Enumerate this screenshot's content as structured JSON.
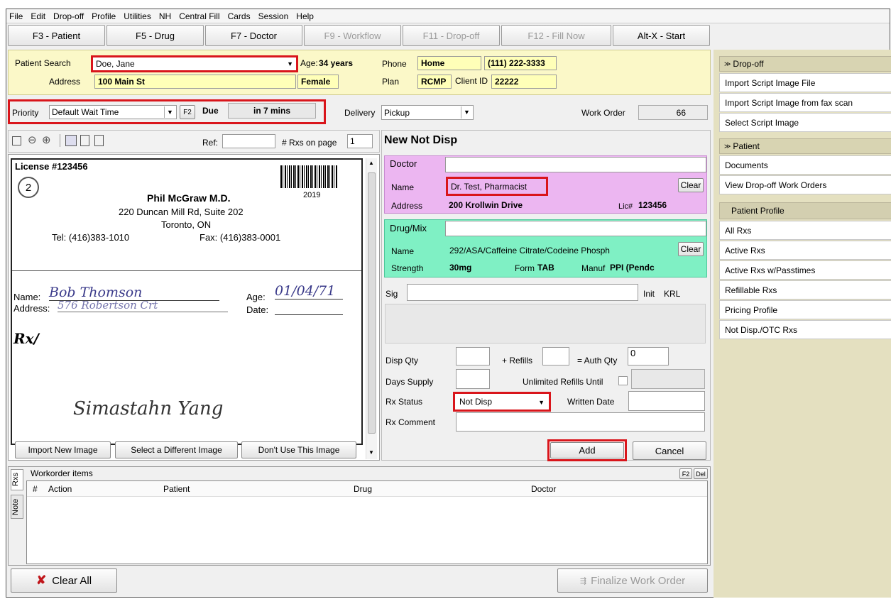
{
  "menu": [
    "File",
    "Edit",
    "Drop-off",
    "Profile",
    "Utilities",
    "NH",
    "Central Fill",
    "Cards",
    "Session",
    "Help"
  ],
  "fkeys": [
    {
      "label": "F3 - Patient",
      "enabled": true
    },
    {
      "label": "F5 - Drug",
      "enabled": true
    },
    {
      "label": "F7 - Doctor",
      "enabled": true
    },
    {
      "label": "F9 - Workflow",
      "enabled": false
    },
    {
      "label": "F11 - Drop-off",
      "enabled": false
    },
    {
      "label": "F12 - Fill Now",
      "enabled": false
    },
    {
      "label": "Alt-X - Start",
      "enabled": true
    }
  ],
  "patient": {
    "search_label": "Patient Search",
    "search_value": "Doe, Jane",
    "age_label": "Age:",
    "age_value": "34 years",
    "phone_label": "Phone",
    "phone_type": "Home",
    "phone_value": "(111) 222-3333",
    "address_label": "Address",
    "address_value": "100 Main St",
    "gender": "Female",
    "plan_label": "Plan",
    "plan_value": "RCMP",
    "client_id_label": "Client ID",
    "client_id_value": "22222"
  },
  "priority": {
    "label": "Priority",
    "value": "Default Wait Time",
    "f2": "F2",
    "due_label": "Due",
    "due_value": "in 7 mins"
  },
  "delivery": {
    "label": "Delivery",
    "value": "Pickup"
  },
  "work_order": {
    "label": "Work Order",
    "value": "66"
  },
  "image_toolbar": {
    "ref_label": "Ref:",
    "ref_value": "",
    "rxs_label": "# Rxs on page",
    "rxs_value": "1"
  },
  "script_image": {
    "license": "License #123456",
    "number": "2",
    "doctor": "Phil McGraw M.D.",
    "year": "2019",
    "address1": "220 Duncan Mill Rd, Suite 202",
    "address2": "Toronto, ON",
    "tel": "Tel: (416)383-1010",
    "fax": "Fax: (416)383-0001",
    "name_label": "Name:",
    "name_value": "Bob Thomson",
    "age_label": "Age:",
    "age_value": "01/04/71",
    "address_label": "Address:",
    "address_value": "576 Robertson Crt",
    "date_label": "Date:",
    "rx": "Rx/",
    "signature": "Simastahn Yang"
  },
  "image_buttons": [
    "Import New Image",
    "Select a Different Image",
    "Don't Use This Image"
  ],
  "form": {
    "title": "New Not Disp",
    "doctor_section": "Doctor",
    "doctor_name_label": "Name",
    "doctor_name": "Dr. Test, Pharmacist",
    "clear": "Clear",
    "doctor_address_label": "Address",
    "doctor_address": "200 Krollwin Drive",
    "lic_label": "Lic#",
    "lic_value": "123456",
    "drug_section": "Drug/Mix",
    "drug_name_label": "Name",
    "drug_name": "292/ASA/Caffeine Citrate/Codeine Phosph",
    "strength_label": "Strength",
    "strength_value": "30mg",
    "form_label": "Form",
    "form_value": "TAB",
    "manuf_label": "Manuf",
    "manuf_value": "PPI (Pendc",
    "sig_label": "Sig",
    "init_label": "Init",
    "init_value": "KRL",
    "disp_qty_label": "Disp Qty",
    "refills_label": "+ Refills",
    "auth_qty_label": "= Auth Qty",
    "auth_qty_value": "0",
    "days_supply_label": "Days Supply",
    "unlimited_label": "Unlimited Refills Until",
    "rx_status_label": "Rx Status",
    "rx_status_value": "Not Disp",
    "written_date_label": "Written Date",
    "rx_comment_label": "Rx Comment",
    "add": "Add",
    "cancel": "Cancel"
  },
  "workorder": {
    "title": "Workorder items",
    "f2": "F2",
    "del": "Del",
    "side_tabs": [
      "Rxs",
      "Note"
    ],
    "columns": [
      "#",
      "Action",
      "Patient",
      "Drug",
      "Doctor"
    ]
  },
  "footer": {
    "clear_all": "Clear All",
    "finalize": "Finalize Work Order"
  },
  "sidebar": {
    "dropoff_header": "Drop-off",
    "dropoff_items": [
      "Import Script Image File",
      "Import Script Image from fax scan",
      "Select Script Image"
    ],
    "patient_header": "Patient",
    "patient_items": [
      "Documents",
      "View Drop-off Work Orders"
    ],
    "profile_header": "Patient Profile",
    "profile_items": [
      "All Rxs",
      "Active Rxs",
      "Active Rxs w/Passtimes",
      "Refillable Rxs",
      "Pricing Profile",
      "Not Disp./OTC Rxs"
    ]
  },
  "colors": {
    "highlight_red": "#d9151b",
    "doctor_bg": "#ecb6f1",
    "drug_bg": "#7ff0c4",
    "patient_bg": "#fbf8c8",
    "sidebar_bg": "#e4e0c0"
  }
}
